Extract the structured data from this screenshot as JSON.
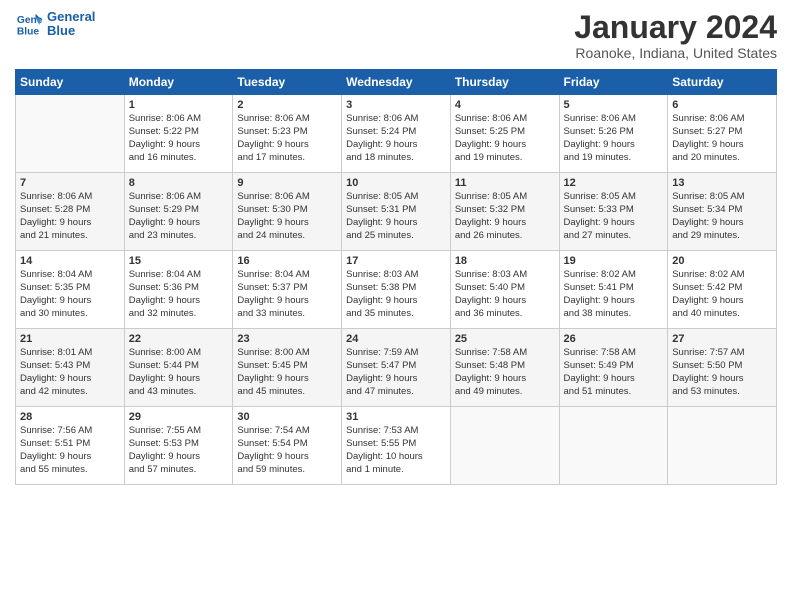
{
  "logo": {
    "line1": "General",
    "line2": "Blue"
  },
  "title": "January 2024",
  "location": "Roanoke, Indiana, United States",
  "days_of_week": [
    "Sunday",
    "Monday",
    "Tuesday",
    "Wednesday",
    "Thursday",
    "Friday",
    "Saturday"
  ],
  "weeks": [
    [
      {
        "day": "",
        "info": ""
      },
      {
        "day": "1",
        "info": "Sunrise: 8:06 AM\nSunset: 5:22 PM\nDaylight: 9 hours\nand 16 minutes."
      },
      {
        "day": "2",
        "info": "Sunrise: 8:06 AM\nSunset: 5:23 PM\nDaylight: 9 hours\nand 17 minutes."
      },
      {
        "day": "3",
        "info": "Sunrise: 8:06 AM\nSunset: 5:24 PM\nDaylight: 9 hours\nand 18 minutes."
      },
      {
        "day": "4",
        "info": "Sunrise: 8:06 AM\nSunset: 5:25 PM\nDaylight: 9 hours\nand 19 minutes."
      },
      {
        "day": "5",
        "info": "Sunrise: 8:06 AM\nSunset: 5:26 PM\nDaylight: 9 hours\nand 19 minutes."
      },
      {
        "day": "6",
        "info": "Sunrise: 8:06 AM\nSunset: 5:27 PM\nDaylight: 9 hours\nand 20 minutes."
      }
    ],
    [
      {
        "day": "7",
        "info": "Sunrise: 8:06 AM\nSunset: 5:28 PM\nDaylight: 9 hours\nand 21 minutes."
      },
      {
        "day": "8",
        "info": "Sunrise: 8:06 AM\nSunset: 5:29 PM\nDaylight: 9 hours\nand 23 minutes."
      },
      {
        "day": "9",
        "info": "Sunrise: 8:06 AM\nSunset: 5:30 PM\nDaylight: 9 hours\nand 24 minutes."
      },
      {
        "day": "10",
        "info": "Sunrise: 8:05 AM\nSunset: 5:31 PM\nDaylight: 9 hours\nand 25 minutes."
      },
      {
        "day": "11",
        "info": "Sunrise: 8:05 AM\nSunset: 5:32 PM\nDaylight: 9 hours\nand 26 minutes."
      },
      {
        "day": "12",
        "info": "Sunrise: 8:05 AM\nSunset: 5:33 PM\nDaylight: 9 hours\nand 27 minutes."
      },
      {
        "day": "13",
        "info": "Sunrise: 8:05 AM\nSunset: 5:34 PM\nDaylight: 9 hours\nand 29 minutes."
      }
    ],
    [
      {
        "day": "14",
        "info": "Sunrise: 8:04 AM\nSunset: 5:35 PM\nDaylight: 9 hours\nand 30 minutes."
      },
      {
        "day": "15",
        "info": "Sunrise: 8:04 AM\nSunset: 5:36 PM\nDaylight: 9 hours\nand 32 minutes."
      },
      {
        "day": "16",
        "info": "Sunrise: 8:04 AM\nSunset: 5:37 PM\nDaylight: 9 hours\nand 33 minutes."
      },
      {
        "day": "17",
        "info": "Sunrise: 8:03 AM\nSunset: 5:38 PM\nDaylight: 9 hours\nand 35 minutes."
      },
      {
        "day": "18",
        "info": "Sunrise: 8:03 AM\nSunset: 5:40 PM\nDaylight: 9 hours\nand 36 minutes."
      },
      {
        "day": "19",
        "info": "Sunrise: 8:02 AM\nSunset: 5:41 PM\nDaylight: 9 hours\nand 38 minutes."
      },
      {
        "day": "20",
        "info": "Sunrise: 8:02 AM\nSunset: 5:42 PM\nDaylight: 9 hours\nand 40 minutes."
      }
    ],
    [
      {
        "day": "21",
        "info": "Sunrise: 8:01 AM\nSunset: 5:43 PM\nDaylight: 9 hours\nand 42 minutes."
      },
      {
        "day": "22",
        "info": "Sunrise: 8:00 AM\nSunset: 5:44 PM\nDaylight: 9 hours\nand 43 minutes."
      },
      {
        "day": "23",
        "info": "Sunrise: 8:00 AM\nSunset: 5:45 PM\nDaylight: 9 hours\nand 45 minutes."
      },
      {
        "day": "24",
        "info": "Sunrise: 7:59 AM\nSunset: 5:47 PM\nDaylight: 9 hours\nand 47 minutes."
      },
      {
        "day": "25",
        "info": "Sunrise: 7:58 AM\nSunset: 5:48 PM\nDaylight: 9 hours\nand 49 minutes."
      },
      {
        "day": "26",
        "info": "Sunrise: 7:58 AM\nSunset: 5:49 PM\nDaylight: 9 hours\nand 51 minutes."
      },
      {
        "day": "27",
        "info": "Sunrise: 7:57 AM\nSunset: 5:50 PM\nDaylight: 9 hours\nand 53 minutes."
      }
    ],
    [
      {
        "day": "28",
        "info": "Sunrise: 7:56 AM\nSunset: 5:51 PM\nDaylight: 9 hours\nand 55 minutes."
      },
      {
        "day": "29",
        "info": "Sunrise: 7:55 AM\nSunset: 5:53 PM\nDaylight: 9 hours\nand 57 minutes."
      },
      {
        "day": "30",
        "info": "Sunrise: 7:54 AM\nSunset: 5:54 PM\nDaylight: 9 hours\nand 59 minutes."
      },
      {
        "day": "31",
        "info": "Sunrise: 7:53 AM\nSunset: 5:55 PM\nDaylight: 10 hours\nand 1 minute."
      },
      {
        "day": "",
        "info": ""
      },
      {
        "day": "",
        "info": ""
      },
      {
        "day": "",
        "info": ""
      }
    ]
  ]
}
